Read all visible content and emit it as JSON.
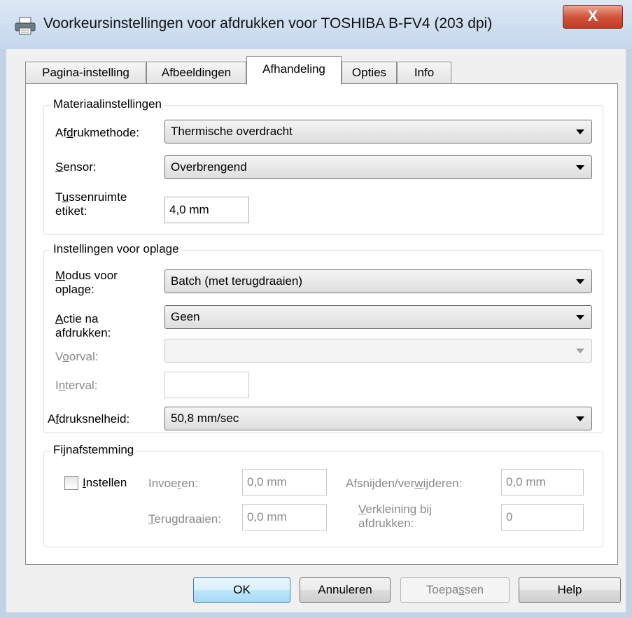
{
  "window": {
    "title": "Voorkeursinstellingen voor afdrukken voor TOSHIBA B-FV4 (203 dpi)",
    "close_glyph": "X"
  },
  "tabs": [
    {
      "label": "Pagina-instelling"
    },
    {
      "label": "Afbeeldingen"
    },
    {
      "label": "Afhandeling"
    },
    {
      "label": "Opties"
    },
    {
      "label": "Info"
    }
  ],
  "material": {
    "legend": "Materiaalinstellingen",
    "print_method": {
      "label_pre": "Af",
      "label_u": "d",
      "label_post": "rukmethode:",
      "value": "Thermische overdracht"
    },
    "sensor": {
      "label_u": "S",
      "label_post": "ensor:",
      "value": "Overbrengend"
    },
    "gap": {
      "label_line1_pre": "T",
      "label_line1_u": "u",
      "label_line1_post": "ssenruimte",
      "label_line2": "etiket:",
      "value": "4,0 mm"
    }
  },
  "issue": {
    "legend": "Instellingen voor oplage",
    "mode": {
      "label_line1_u": "M",
      "label_line1_post": "odus voor",
      "label_line2": "oplage:",
      "value": "Batch (met terugdraaien)"
    },
    "action": {
      "label_line1_u": "A",
      "label_line1_post": "ctie na",
      "label_line2": "afdrukken:",
      "value": "Geen"
    },
    "prefix": {
      "label_pre": "V",
      "label_u": "o",
      "label_post": "orval:",
      "value": ""
    },
    "interval": {
      "label_pre": "I",
      "label_u": "n",
      "label_post": "terval:",
      "value": ""
    },
    "speed": {
      "label_pre": "A",
      "label_u": "f",
      "label_post": "druksnelheid:",
      "value": "50,8 mm/sec"
    }
  },
  "finetune": {
    "legend": "Fijnafstemming",
    "checkbox": {
      "label_u": "I",
      "label_post": "nstellen",
      "checked": false
    },
    "feed": {
      "label_pre": "Invoe",
      "label_u": "r",
      "label_post": "en:",
      "value": "0,0 mm"
    },
    "cut": {
      "label_pre": "Afsnijden/ver",
      "label_u": "w",
      "label_post": "ijderen:",
      "value": "0,0 mm"
    },
    "backfeed": {
      "label_u": "T",
      "label_post": "erugdraaien:",
      "value": "0,0 mm"
    },
    "reduce": {
      "label_line1_u": "V",
      "label_line1_post": "erkleining bij",
      "label_line2": "afdrukken:",
      "value": "0"
    }
  },
  "buttons": {
    "ok": "OK",
    "cancel": "Annuleren",
    "apply_pre": "Toepa",
    "apply_u": "s",
    "apply_post": "sen",
    "help": "Help"
  }
}
